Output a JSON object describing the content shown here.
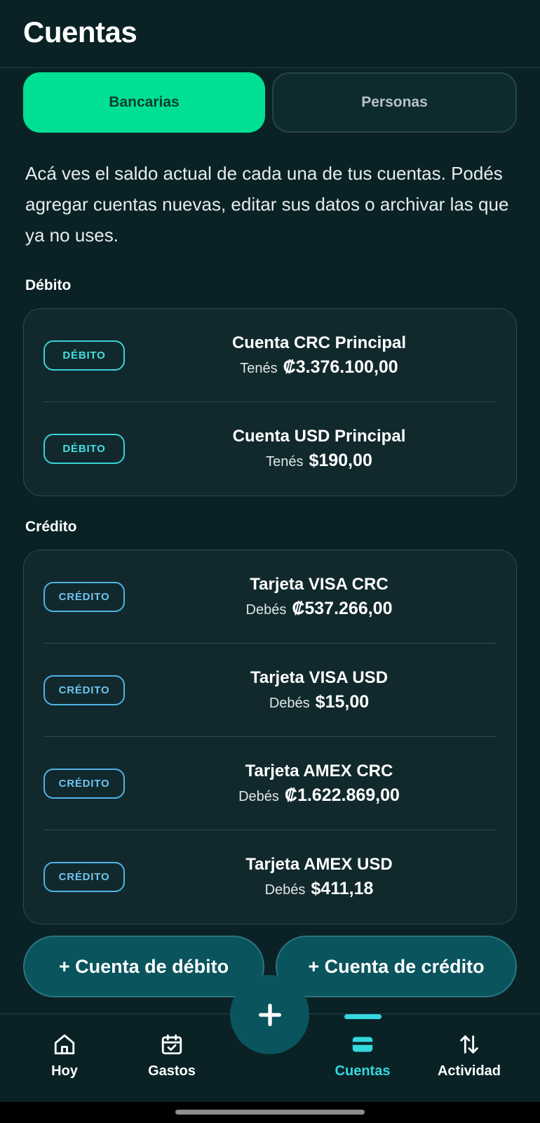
{
  "header": {
    "title": "Cuentas"
  },
  "tabs": [
    {
      "label": "Bancarias",
      "active": true
    },
    {
      "label": "Personas",
      "active": false
    }
  ],
  "description": "Acá ves el saldo actual de cada una de tus cuentas. Podés agregar cuentas nuevas, editar sus datos o archivar las que ya no uses.",
  "sections": {
    "debito": {
      "label": "Débito",
      "accounts": [
        {
          "badge": "DÉBITO",
          "name": "Cuenta CRC Principal",
          "prefix": "Tenés",
          "amount": "₡3.376.100,00"
        },
        {
          "badge": "DÉBITO",
          "name": "Cuenta USD Principal",
          "prefix": "Tenés",
          "amount": "$190,00"
        }
      ]
    },
    "credito": {
      "label": "Crédito",
      "accounts": [
        {
          "badge": "CRÉDITO",
          "name": "Tarjeta VISA CRC",
          "prefix": "Debés",
          "amount": "₡537.266,00"
        },
        {
          "badge": "CRÉDITO",
          "name": "Tarjeta VISA USD",
          "prefix": "Debés",
          "amount": "$15,00"
        },
        {
          "badge": "CRÉDITO",
          "name": "Tarjeta AMEX CRC",
          "prefix": "Debés",
          "amount": "₡1.622.869,00"
        },
        {
          "badge": "CRÉDITO",
          "name": "Tarjeta AMEX USD",
          "prefix": "Debés",
          "amount": "$411,18"
        }
      ]
    }
  },
  "actions": {
    "add_debit": "+ Cuenta de débito",
    "add_credit": "+ Cuenta de crédito"
  },
  "bottom_nav": {
    "items": [
      {
        "label": "Hoy",
        "icon": "home-icon"
      },
      {
        "label": "Gastos",
        "icon": "calendar-check-icon"
      },
      {
        "label": "Cuentas",
        "icon": "card-icon",
        "active": true
      },
      {
        "label": "Actividad",
        "icon": "arrows-up-down-icon"
      }
    ],
    "fab_icon": "plus-icon"
  },
  "colors": {
    "background": "#0a2226",
    "accent_green": "#00e092",
    "accent_cyan": "#33d9de",
    "card": "#11292d",
    "button": "#0a545d"
  }
}
